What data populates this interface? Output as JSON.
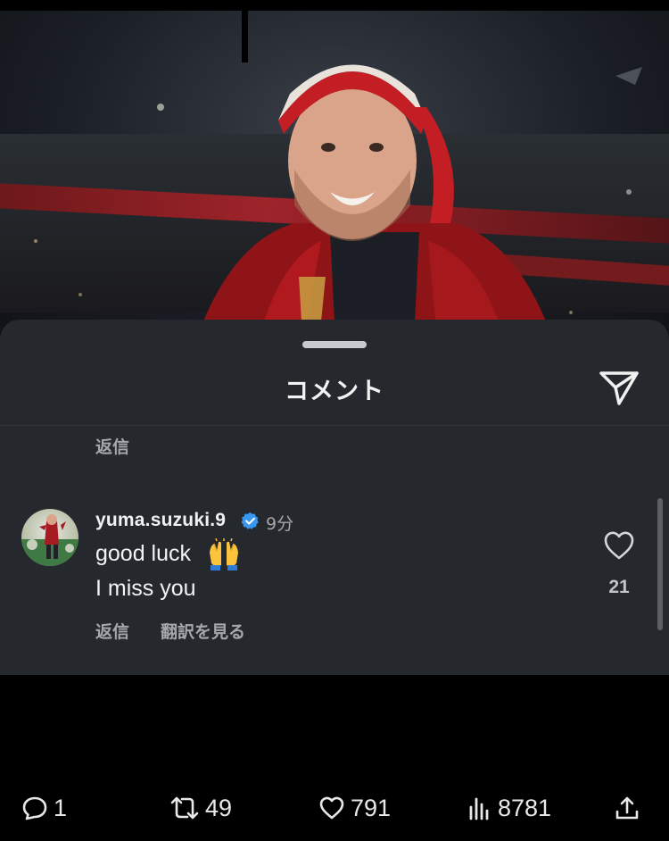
{
  "sheet": {
    "title": "コメント",
    "icons": {
      "send": "paper-plane-icon",
      "like": "heart-outline-icon",
      "verified": "verified-badge-icon"
    }
  },
  "previous_comment": {
    "reply_label": "返信"
  },
  "comment": {
    "username": "yuma.suzuki.9",
    "time": "9分",
    "line1": "good luck",
    "emoji": "raised-hands-emoji",
    "line2": "I miss you",
    "reply_label": "返信",
    "translate_label": "翻訳を見る",
    "like_count": "21"
  },
  "stats": {
    "replies": "1",
    "reposts": "49",
    "likes": "791",
    "views": "8781",
    "icons": [
      "comment-icon",
      "repost-icon",
      "heart-icon",
      "views-chart-icon",
      "share-icon"
    ]
  },
  "colors": {
    "sheet_bg": "#25282d",
    "secondary_text": "#a4a7ad",
    "verified_blue": "#3897f0",
    "accent_red": "#b4232a"
  }
}
